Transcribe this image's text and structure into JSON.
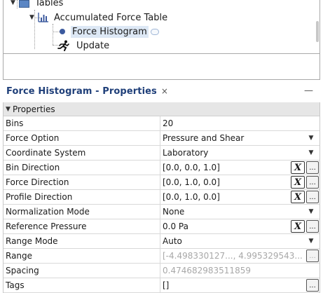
{
  "tree": {
    "items": [
      {
        "label": "Tables",
        "icon": "folder-icon"
      },
      {
        "label": "Accumulated Force Table",
        "icon": "chart-icon"
      },
      {
        "label": "Force Histogram",
        "icon": "dot-icon",
        "selected": true
      },
      {
        "label": "Update",
        "icon": "runner-icon"
      }
    ]
  },
  "properties_panel": {
    "title": "Force Histogram - Properties",
    "close_glyph": "×",
    "minimize_glyph": "—",
    "section": "Properties",
    "rows": [
      {
        "name": "Bins",
        "value": "20"
      },
      {
        "name": "Force Option",
        "value": "Pressure and Shear"
      },
      {
        "name": "Coordinate System",
        "value": "Laboratory"
      },
      {
        "name": "Bin Direction",
        "value": "[0.0, 0.0, 1.0]"
      },
      {
        "name": "Force Direction",
        "value": "[0.0, 1.0, 0.0]"
      },
      {
        "name": "Profile Direction",
        "value": "[0.0, 1.0, 0.0]"
      },
      {
        "name": "Normalization Mode",
        "value": "None"
      },
      {
        "name": "Reference Pressure",
        "value": "0.0 Pa"
      },
      {
        "name": "Range Mode",
        "value": "Auto"
      },
      {
        "name": "Range",
        "value": "[-4.498330127..., 4.995329543..."
      },
      {
        "name": "Spacing",
        "value": "0.474682983511859"
      },
      {
        "name": "Tags",
        "value": "[]"
      }
    ],
    "x_button_label": "X",
    "ellipsis_label": "..."
  },
  "colors": {
    "title_blue": "#1f3f79",
    "selection": "#dde8f5",
    "section_bg": "#e6e6e6",
    "disabled_text": "#a8a8a8"
  }
}
